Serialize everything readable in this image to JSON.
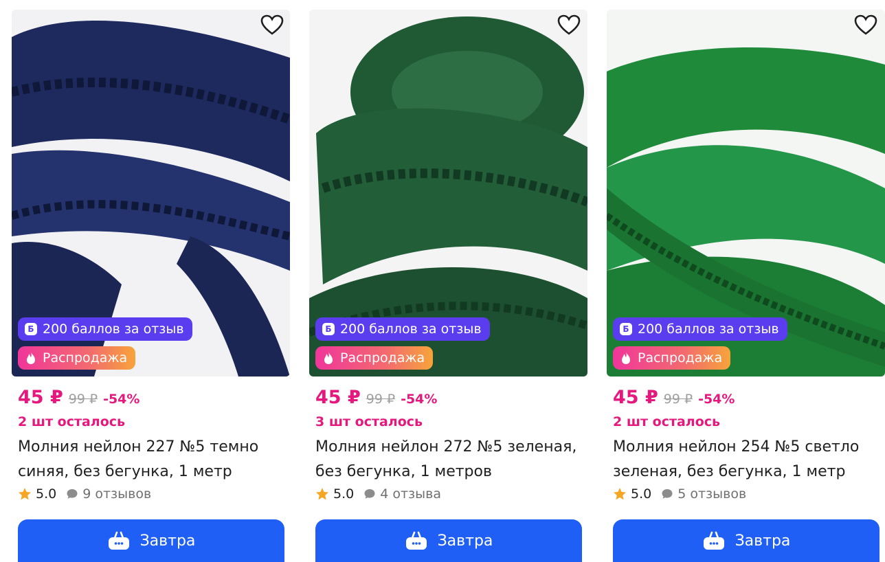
{
  "products": [
    {
      "image_color": "#1e2a5e",
      "points_badge": "200 баллов за отзыв",
      "points_icon": "Б",
      "sale_badge": "Распродажа",
      "price": "45 ₽",
      "old_price": "99 ₽",
      "discount": "-54%",
      "stock": "2 шт осталось",
      "title": "Молния нейлон 227 №5 темно синяя, без бегунка, 1 метр",
      "rating": "5.0",
      "reviews": "9 отзывов",
      "delivery": "Завтра"
    },
    {
      "image_color": "#1f5a35",
      "points_badge": "200 баллов за отзыв",
      "points_icon": "Б",
      "sale_badge": "Распродажа",
      "price": "45 ₽",
      "old_price": "99 ₽",
      "discount": "-54%",
      "stock": "3 шт осталось",
      "title": "Молния нейлон 272 №5 зеленая, без бегунка, 1 метров",
      "rating": "5.0",
      "reviews": "4 отзыва",
      "delivery": "Завтра"
    },
    {
      "image_color": "#1f8a3a",
      "points_badge": "200 баллов за отзыв",
      "points_icon": "Б",
      "sale_badge": "Распродажа",
      "price": "45 ₽",
      "old_price": "99 ₽",
      "discount": "-54%",
      "stock": "2 шт осталось",
      "title": "Молния нейлон 254 №5 светло зеленая, без бегунка, 1 метр",
      "rating": "5.0",
      "reviews": "5 отзывов",
      "delivery": "Завтра"
    }
  ],
  "icons": {
    "favorite": "heart-icon",
    "sale": "fire-icon",
    "rating": "star-icon",
    "reviews": "comment-icon",
    "cart": "basket-icon"
  },
  "colors": {
    "accent": "#e5197d",
    "button": "#1f5ff6",
    "points_badge": "#5b3df0"
  }
}
